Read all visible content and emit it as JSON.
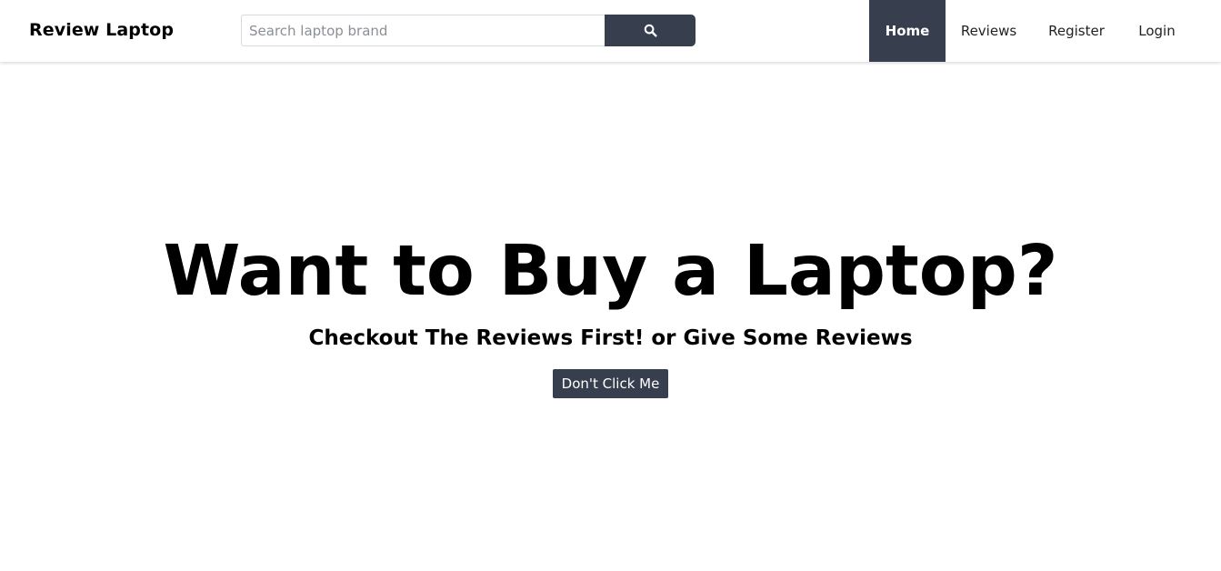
{
  "navbar": {
    "brand": "Review Laptop",
    "search": {
      "placeholder": "Search laptop brand",
      "value": "",
      "button_icon": "search-icon"
    },
    "links": [
      {
        "label": "Home",
        "active": true
      },
      {
        "label": "Reviews",
        "active": false
      },
      {
        "label": "Register",
        "active": false
      },
      {
        "label": "Login",
        "active": false
      }
    ]
  },
  "hero": {
    "title": "Want to Buy a Laptop?",
    "subtitle": "Checkout The Reviews First! or Give Some Reviews",
    "button_label": "Don't Click Me"
  },
  "colors": {
    "accent": "#373e4e",
    "text": "#000000",
    "background": "#ffffff",
    "active_link_text": "#ffffff"
  }
}
